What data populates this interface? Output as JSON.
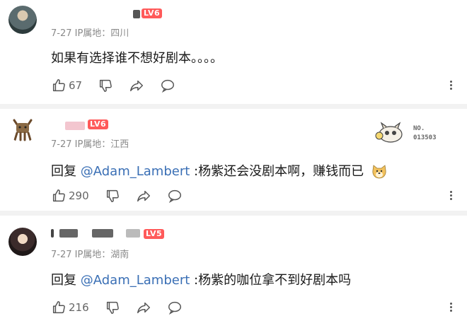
{
  "comments": [
    {
      "level": "LV6",
      "meta": "7-27  IP属地：四川",
      "text": "如果有选择谁不想好剧本。。。。",
      "likes": "67",
      "reply_prefix": "",
      "mention": ""
    },
    {
      "level": "LV6",
      "meta": "7-27  IP属地：江西",
      "reply_prefix": "回复 ",
      "mention": "@Adam_Lambert",
      "text": " :杨紫还会没剧本啊，赚钱而已",
      "likes": "290",
      "badge_text": "NO.\n013503"
    },
    {
      "level": "LV5",
      "meta": "7-27  IP属地：湖南",
      "reply_prefix": "回复 ",
      "mention": "@Adam_Lambert",
      "text": " :杨紫的咖位拿不到好剧本吗",
      "likes": "216"
    }
  ],
  "icons": [
    "thumbs-up-icon",
    "thumbs-down-icon",
    "share-icon",
    "comment-icon",
    "more-icon"
  ],
  "colors": {
    "level_badge": "#ff5a5a",
    "mention": "#3a6fb5",
    "meta": "#8a8a8a"
  }
}
